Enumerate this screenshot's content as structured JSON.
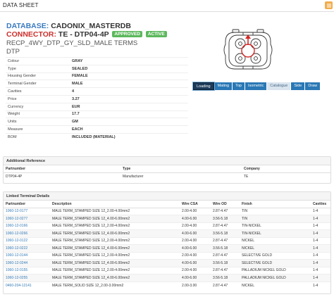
{
  "window": {
    "title": "DATA SHEET",
    "menu_icon": "hamburger-icon"
  },
  "header": {
    "database_label": "DATABASE:",
    "database_value": "CADONIX_MASTERDB",
    "connector_label": "CONNECTOR:",
    "connector_value": "TE - DTP04-4P",
    "badges": [
      "APPROVED",
      "ACTIVE"
    ],
    "description": "RECP_4WY_DTP_GY_SLD_MALE TERMS",
    "family": "DTP"
  },
  "properties": [
    {
      "key": "Colour",
      "value": "GRAY"
    },
    {
      "key": "Type",
      "value": "SEALED"
    },
    {
      "key": "Housing Gender",
      "value": "FEMALE"
    },
    {
      "key": "Terminal Gender",
      "value": "MALE"
    },
    {
      "key": "Cavities",
      "value": "4"
    },
    {
      "key": "Price",
      "value": "3.27"
    },
    {
      "key": "Currency",
      "value": "EUR"
    },
    {
      "key": "Weight",
      "value": "17.7"
    },
    {
      "key": "Units",
      "value": "GM"
    },
    {
      "key": "Measure",
      "value": "EACH"
    },
    {
      "key": "BOM",
      "value": "INCLUDED (MATERIAL)"
    }
  ],
  "view_tabs": [
    "Loading",
    "Mating",
    "Top",
    "Isometric",
    "Catalogue",
    "Side",
    "Draw"
  ],
  "additional_reference": {
    "title": "Additional Reference",
    "columns": [
      "Partnumber",
      "Type",
      "Company"
    ],
    "rows": [
      [
        "DTP04-4P",
        "Manufacturer",
        "TE"
      ]
    ]
  },
  "linked_terminals": {
    "title": "Linked Terminal Details",
    "columns": [
      "Partnumber",
      "Description",
      "Wire CSA",
      "Wire OD",
      "Finish",
      "Cavities"
    ],
    "rows": [
      [
        "1060-12-0177",
        "MALE TERM_STAMPED SIZE 12_2.00-4.00mm2",
        "2.00-4.00",
        "2.87-4.47",
        "TIN",
        "1-4"
      ],
      [
        "1060-12-0277",
        "MALE TERM_STAMPED SIZE 12_4.00-6.00mm2",
        "4.00-6.00",
        "3.56-5.18",
        "TIN",
        "1-4"
      ],
      [
        "1060-12-0166",
        "MALE TERM_STAMPED SIZE 12_2.00-4.00mm2",
        "2.00-4.00",
        "2.87-4.47",
        "TIN-NICKEL",
        "1-4"
      ],
      [
        "1060-12-0266",
        "MALE TERM_STAMPED SIZE 12_4.00-6.00mm2",
        "4.00-6.00",
        "3.56-5.18",
        "TIN-NICKEL",
        "1-4"
      ],
      [
        "1060-12-0122",
        "MALE TERM_STAMPED SIZE 12_2.00-4.00mm2",
        "2.00-4.00",
        "2.87-4.47",
        "NICKEL",
        "1-4"
      ],
      [
        "1060-12-0222",
        "MALE TERM_STAMPED SIZE 12_4.00-6.00mm2",
        "4.00-6.00",
        "3.56-5.18",
        "NICKEL",
        "1-4"
      ],
      [
        "1060-12-0144",
        "MALE TERM_STAMPED SIZE 12_2.00-4.00mm2",
        "2.00-4.00",
        "2.87-4.47",
        "SELECTIVE GOLD",
        "1-4"
      ],
      [
        "1060-12-0244",
        "MALE TERM_STAMPED SIZE 12_4.00-6.00mm2",
        "4.00-6.00",
        "3.56-5.18",
        "SELECTIVE GOLD",
        "1-4"
      ],
      [
        "1060-12-0155",
        "MALE TERM_STAMPED SIZE 12_2.00-4.00mm2",
        "2.00-4.00",
        "2.87-4.47",
        "PALLADIUM NICKEL GOLD",
        "1-4"
      ],
      [
        "1060-12-0255",
        "MALE TERM_STAMPED SIZE 12_4.00-6.00mm2",
        "4.00-6.00",
        "3.56-5.18",
        "PALLADIUM NICKEL GOLD",
        "1-4"
      ],
      [
        "0460-204-12141",
        "MALE TERM_SOLID SIZE 12_2.00-3.00mm2",
        "2.00-3.00",
        "2.87-4.47",
        "NICKEL",
        "1-4"
      ]
    ]
  }
}
